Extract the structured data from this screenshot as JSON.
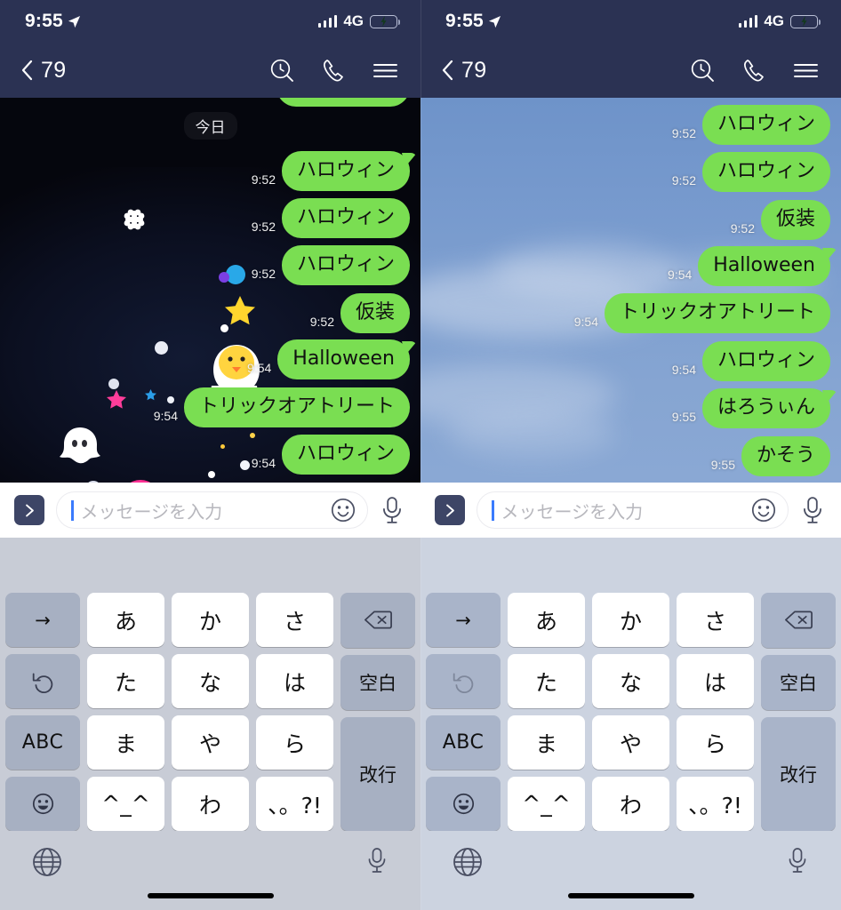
{
  "status_bar": {
    "time": "9:55",
    "network": "4G",
    "location_icon": "location-arrow-icon",
    "signal_icon": "signal-bars-icon",
    "battery_icon": "battery-charging-icon"
  },
  "nav_bar": {
    "back_icon": "chevron-left-icon",
    "title": "79",
    "search_icon": "search-history-icon",
    "call_icon": "phone-icon",
    "menu_icon": "hamburger-menu-icon"
  },
  "chat_left": {
    "wallpaper": "halloween-dark",
    "date_label": "今日",
    "bubble_color": "#7ade52",
    "messages": [
      {
        "text": "ハロウィン",
        "time": "9:52",
        "tail": true
      },
      {
        "text": "ハロウィン",
        "time": "9:52",
        "tail": false
      },
      {
        "text": "ハロウィン",
        "time": "9:52",
        "tail": false
      },
      {
        "text": "仮装",
        "time": "9:52",
        "tail": false
      },
      {
        "text": "Halloween",
        "time": "9:54",
        "tail": true
      },
      {
        "text": "トリックオアトリート",
        "time": "9:54",
        "tail": false
      },
      {
        "text": "ハロウィン",
        "time": "9:54",
        "tail": false
      }
    ]
  },
  "chat_right": {
    "wallpaper": "blue-sky",
    "bubble_color": "#7ade52",
    "messages": [
      {
        "text": "ハロウィン",
        "time": "9:52",
        "tail": false
      },
      {
        "text": "ハロウィン",
        "time": "9:52",
        "tail": false
      },
      {
        "text": "仮装",
        "time": "9:52",
        "tail": false
      },
      {
        "text": "Halloween",
        "time": "9:54",
        "tail": true
      },
      {
        "text": "トリックオアトリート",
        "time": "9:54",
        "tail": false
      },
      {
        "text": "ハロウィン",
        "time": "9:54",
        "tail": false
      },
      {
        "text": "はろうぃん",
        "time": "9:55",
        "tail": true
      },
      {
        "text": "かそう",
        "time": "9:55",
        "tail": false
      }
    ]
  },
  "input_bar": {
    "send_icon": "chevron-right-send-icon",
    "placeholder": "メッセージを入力",
    "value": "",
    "emoji_icon": "smiley-face-icon",
    "mic_icon": "microphone-icon"
  },
  "keyboard": {
    "row1": [
      "→",
      "あ",
      "か",
      "さ",
      "delete-icon"
    ],
    "row2": [
      "undo-icon",
      "た",
      "な",
      "は",
      "空白"
    ],
    "row3": [
      "ABC",
      "ま",
      "や",
      "ら",
      "改行"
    ],
    "row4": [
      "emoji-icon",
      "^_^",
      "わ",
      "、。?!"
    ],
    "labels": {
      "arrow_right": "→",
      "a": "あ",
      "ka": "か",
      "sa": "さ",
      "ta": "た",
      "na": "な",
      "ha": "は",
      "ma": "ま",
      "ya": "や",
      "ra": "ら",
      "kaomoji": "^_^",
      "wa": "わ",
      "punct": "、。?!",
      "space": "空白",
      "enter": "改行",
      "abc": "ABC",
      "delete": "delete-icon",
      "undo": "undo-icon",
      "emoji": "emoji-icon"
    },
    "globe_icon": "globe-language-icon",
    "dictate_icon": "microphone-icon",
    "left_undo_enabled": true,
    "right_undo_enabled": false
  }
}
